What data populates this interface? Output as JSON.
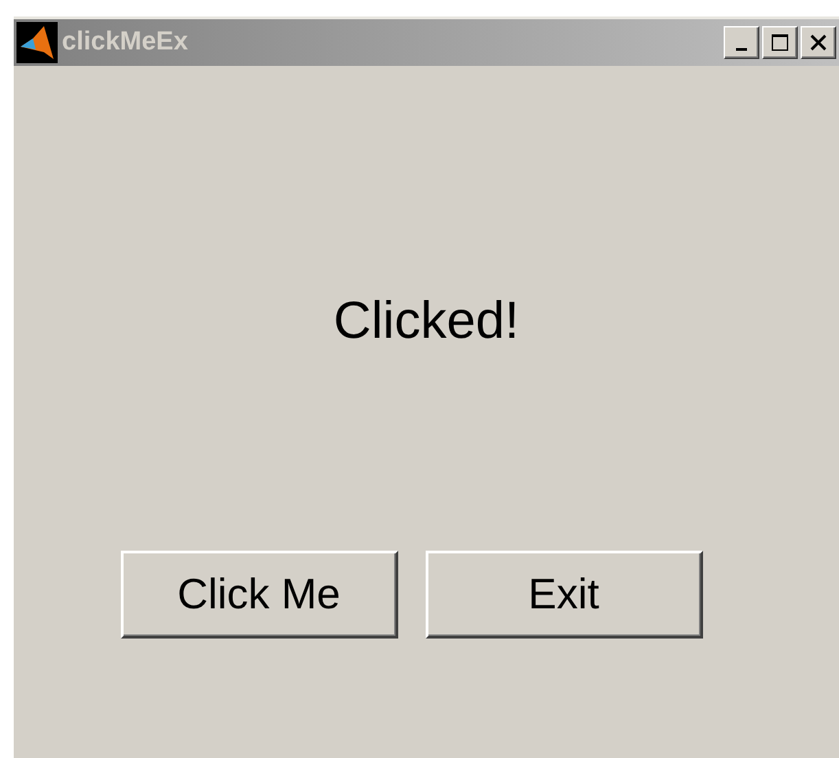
{
  "window": {
    "title": "clickMeEx"
  },
  "message": "Clicked!",
  "buttons": [
    {
      "label": "Click Me"
    },
    {
      "label": "Exit"
    }
  ]
}
